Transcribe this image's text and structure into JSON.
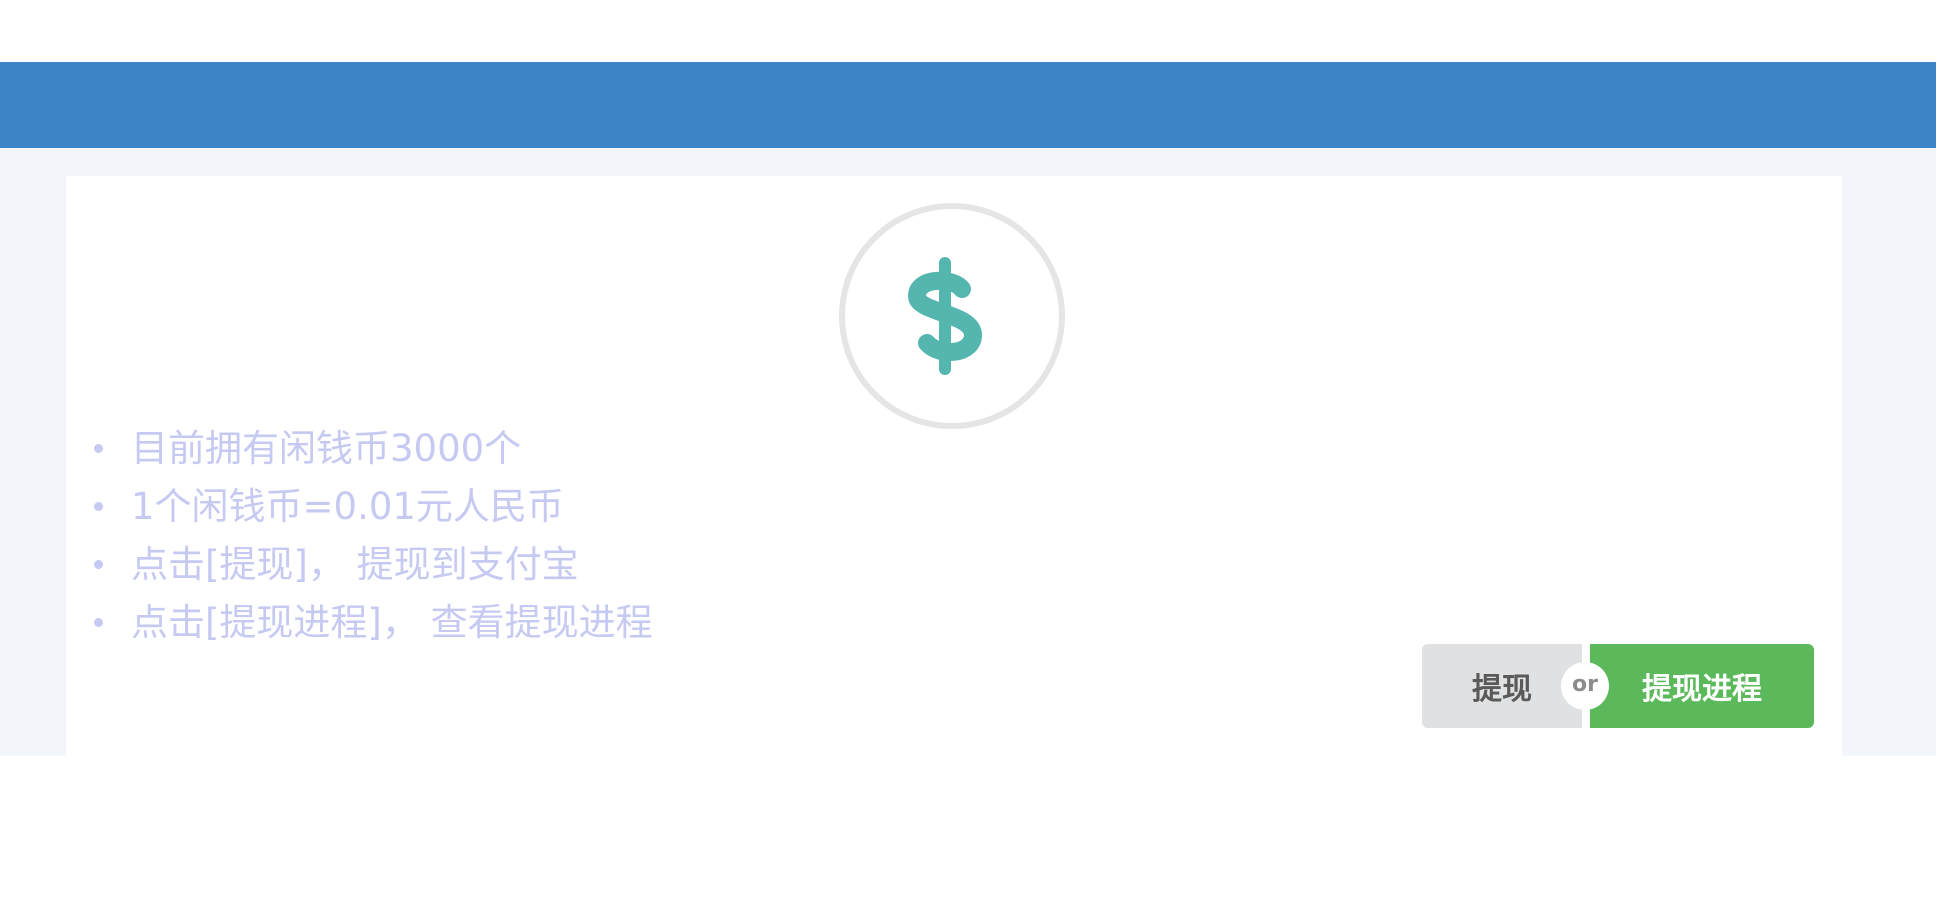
{
  "header": {
    "bar_color": "#3d84c9"
  },
  "coin": {
    "icon": "dollar-icon",
    "symbol_color": "#55b6b0",
    "ring_color": "#e5e5e5"
  },
  "info": {
    "text_color": "#c6c9f2",
    "items": [
      {
        "text": "目前拥有闲钱币3000个"
      },
      {
        "text": "1个闲钱币=0.01元人民币"
      },
      {
        "text": "点击[提现]，  提现到支付宝"
      },
      {
        "text": "点击[提现进程]，  查看提现进程"
      }
    ]
  },
  "actions": {
    "withdraw_label": "提现",
    "or_label": "or",
    "progress_label": "提现进程",
    "withdraw_color": "#e0e1e2",
    "progress_color": "#5bb95b"
  }
}
